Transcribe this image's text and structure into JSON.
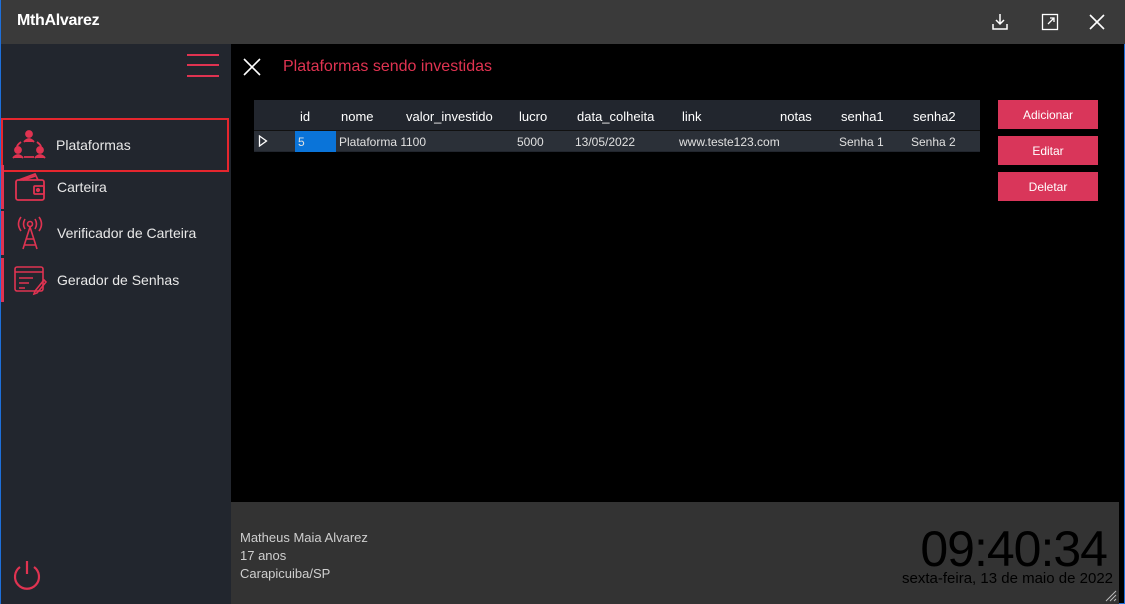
{
  "app": {
    "title": "MthAlvarez"
  },
  "titlebar": {
    "buttons": [
      "download-icon",
      "maximize-icon",
      "close-icon"
    ]
  },
  "sidebar": {
    "items": [
      {
        "label": "Plataformas",
        "icon": "people-network-icon",
        "active": true
      },
      {
        "label": "Carteira",
        "icon": "wallet-icon",
        "active": false
      },
      {
        "label": "Verificador de Carteira",
        "icon": "antenna-icon",
        "active": false
      },
      {
        "label": "Gerador de Senhas",
        "icon": "password-form-icon",
        "active": false
      }
    ]
  },
  "main": {
    "title": "Plataformas sendo investidas",
    "table": {
      "columns": [
        "id",
        "nome",
        "valor_investido",
        "lucro",
        "data_colheita",
        "link",
        "notas",
        "senha1",
        "senha2"
      ],
      "rows": [
        {
          "id": "5",
          "nome": "Plataforma 1",
          "valor_investido": "100",
          "lucro": "5000",
          "data_colheita": "13/05/2022",
          "link": "www.teste123.com",
          "notas": "",
          "senha1": "Senha 1",
          "senha2": "Senha 2"
        }
      ]
    },
    "actions": {
      "add": "Adicionar",
      "edit": "Editar",
      "delete": "Deletar"
    }
  },
  "footer": {
    "user_name": "Matheus Maia Alvarez",
    "user_age": "17 anos",
    "user_city": "Carapicuiba/SP",
    "time": "09:40:34",
    "date": "sexta-feira, 13 de maio de 2022"
  },
  "colors": {
    "accent": "#e03351",
    "selection": "#0a74d9",
    "sidebar": "#22262e"
  }
}
